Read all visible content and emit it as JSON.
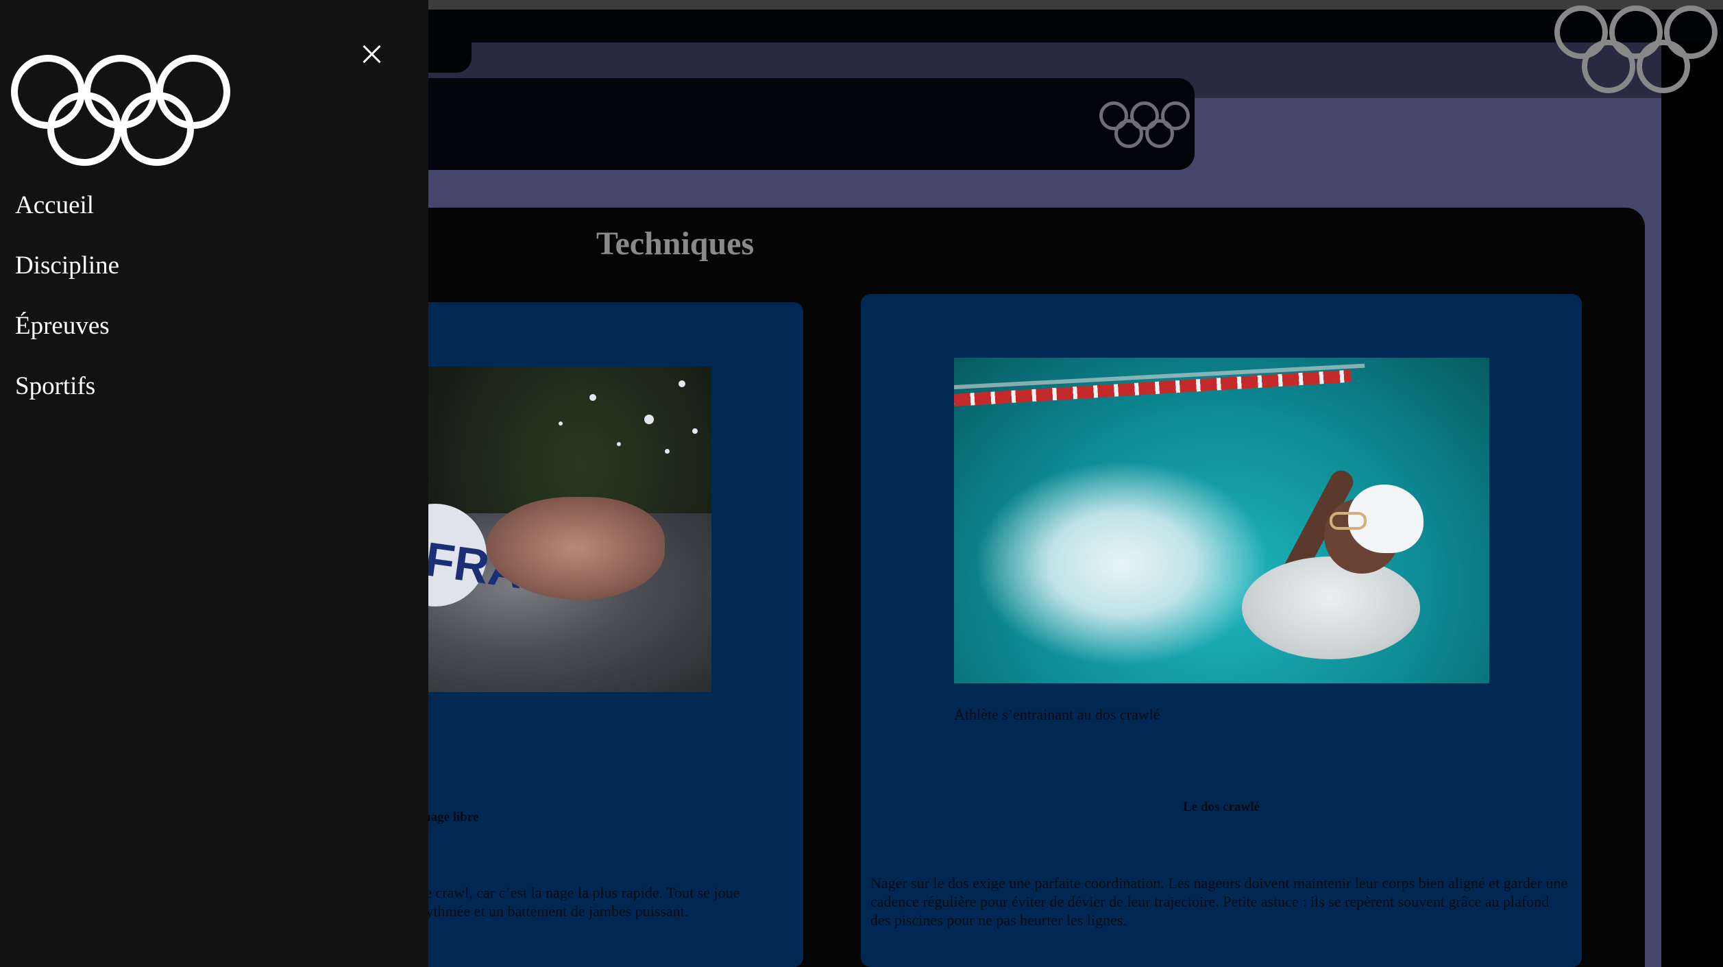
{
  "page": {
    "section_title": "Techniques"
  },
  "cards": [
    {
      "image_alt": "Nageur en nage libre",
      "photo_text": "FRA",
      "heading": "nage libre",
      "paragraph": "le crawl, car c’est la nage la plus rapide. Tout se joue\nrythmée et un battement de jambes puissant."
    },
    {
      "image_alt": "Athlète s’entrainant au dos crawlé",
      "caption": "Athlète s’entrainant au dos crawlé",
      "heading": "Le dos crawlé",
      "paragraph": "Nager sur le dos exige une parfaite coordination. Les nageurs doivent maintenir leur corps bien aligné et garder une cadence régulière pour éviter de dévier de leur trajectoire. Petite astuce : ils se repèrent souvent grâce au plafond des piscines pour ne pas heurter les lignes."
    }
  ],
  "drawer": {
    "nav_items": [
      "Accueil",
      "Discipline",
      "Épreuves",
      "Sportifs"
    ],
    "close_icon": "close-icon",
    "logo_icon": "olympic-rings-icon"
  },
  "colors": {
    "drawer_bg": "#121212",
    "page_accent": "#44466c",
    "card_bg": "#012852"
  }
}
